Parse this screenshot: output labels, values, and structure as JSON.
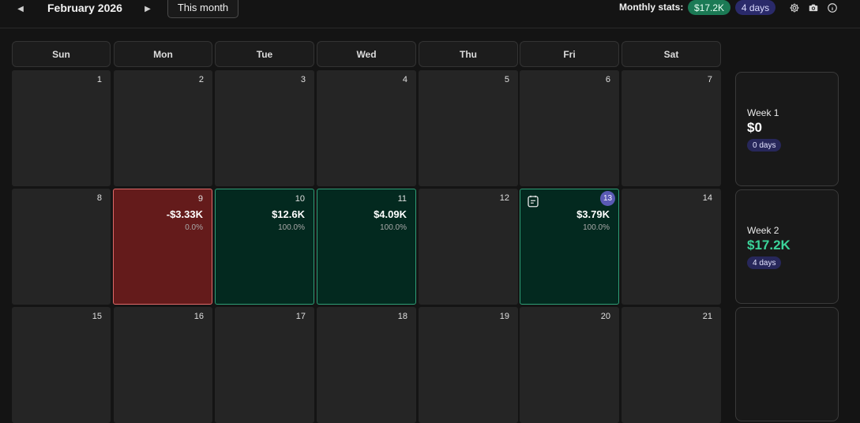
{
  "header": {
    "month_title": "February 2026",
    "this_month_label": "This month",
    "stats_label": "Monthly stats:",
    "stats_money": "$17.2K",
    "stats_days": "4 days",
    "icons": [
      "gear-icon",
      "camera-icon",
      "info-icon"
    ]
  },
  "weekdays": [
    "Sun",
    "Mon",
    "Tue",
    "Wed",
    "Thu",
    "Fri",
    "Sat"
  ],
  "days": {
    "d1": "1",
    "d2": "2",
    "d3": "3",
    "d4": "4",
    "d5": "5",
    "d6": "6",
    "d7": "7",
    "d8": "8",
    "d9": {
      "num": "9",
      "pnl": "-$3.33K",
      "pct": "0.0%"
    },
    "d10": {
      "num": "10",
      "pnl": "$12.6K",
      "pct": "100.0%"
    },
    "d11": {
      "num": "11",
      "pnl": "$4.09K",
      "pct": "100.0%"
    },
    "d12": "12",
    "d13": {
      "num": "13",
      "pnl": "$3.79K",
      "pct": "100.0%"
    },
    "d14": "14",
    "d15": "15",
    "d16": "16",
    "d17": "17",
    "d18": "18",
    "d19": "19",
    "d20": "20",
    "d21": "21"
  },
  "weeks": [
    {
      "title": "Week 1",
      "value": "$0",
      "days": "0 days"
    },
    {
      "title": "Week 2",
      "value": "$17.2K",
      "days": "4 days"
    }
  ],
  "colors": {
    "loss_bg": "#641b1b",
    "profit_bg": "#03291f",
    "profit_accent": "#3bd39a",
    "badge_days": "#2a2a6a"
  }
}
